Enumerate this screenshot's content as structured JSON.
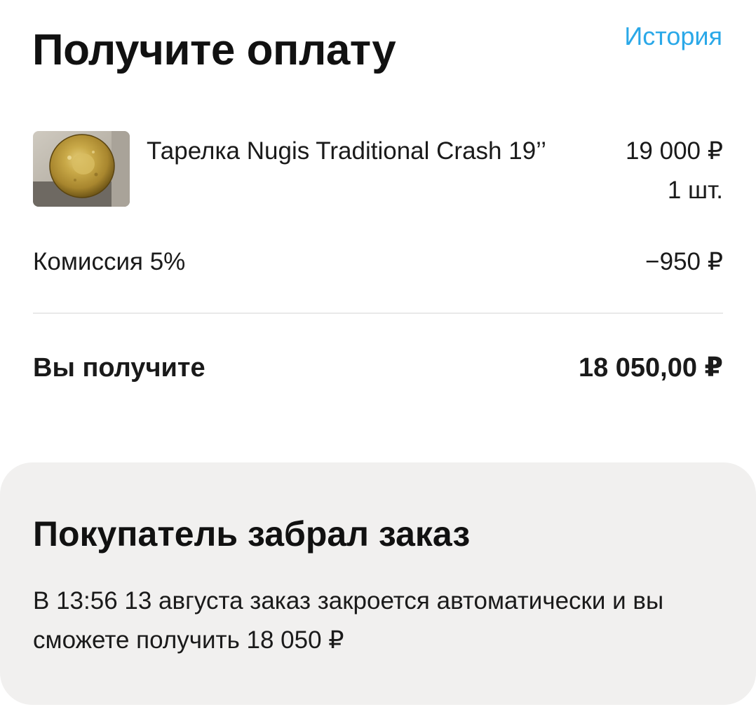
{
  "header": {
    "title": "Получите оплату",
    "history_label": "История",
    "accent_color": "#2aa8e8"
  },
  "order_item": {
    "image_icon": "cymbal-photo",
    "name": "Тарелка Nugis Traditional Crash 19’’",
    "price": "19 000 ₽",
    "quantity": "1 шт."
  },
  "commission": {
    "label": "Комиссия 5%",
    "value": "−950 ₽"
  },
  "total": {
    "label": "Вы получите",
    "value": "18 050,00 ₽"
  },
  "status": {
    "title": "Покупатель забрал заказ",
    "description": "В 13:56 13 августа заказ закроется автоматически и вы сможете получить 18 050 ₽",
    "card_color": "#f1f0ef"
  }
}
